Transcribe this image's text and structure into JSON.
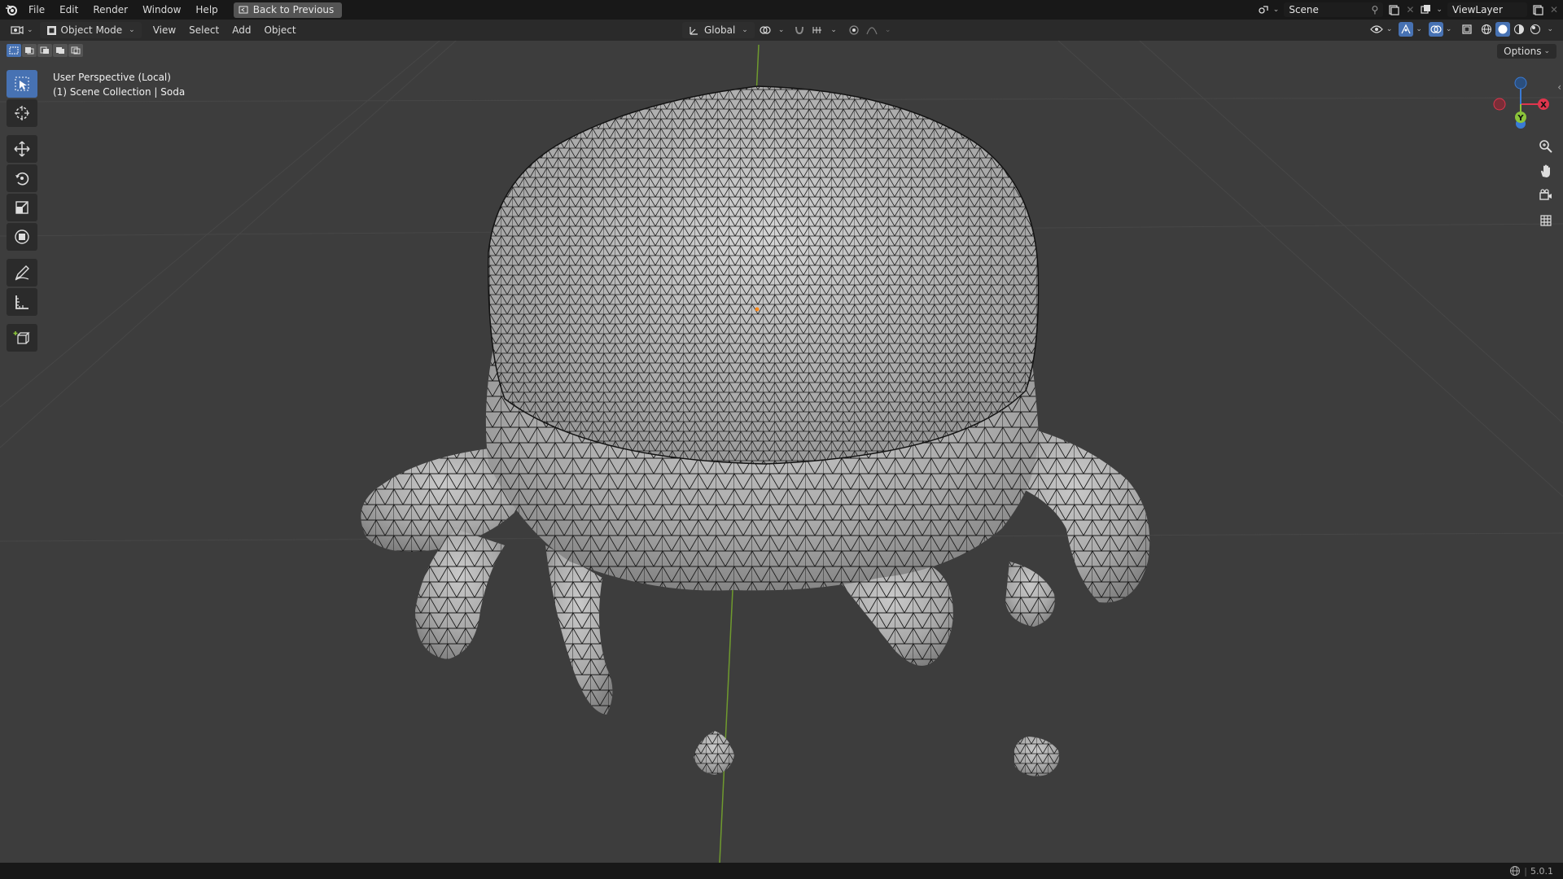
{
  "menu": {
    "items": [
      "File",
      "Edit",
      "Render",
      "Window",
      "Help"
    ],
    "back_button": "Back to Previous"
  },
  "top_right": {
    "scene": "Scene",
    "view_layer": "ViewLayer"
  },
  "header": {
    "mode": "Object Mode",
    "menus": [
      "View",
      "Select",
      "Add",
      "Object"
    ],
    "orientation": "Global",
    "options": "Options"
  },
  "viewport": {
    "perspective": "User Perspective (Local)",
    "collection": "(1) Scene Collection | Soda",
    "gizmo_axes": [
      "X",
      "Y",
      "Z"
    ]
  },
  "status": {
    "version": "5.0.1"
  },
  "colors": {
    "accent": "#4772b3",
    "x_axis": "#e0354d",
    "y_axis": "#8bc43a",
    "z_axis": "#3a7bd5"
  }
}
